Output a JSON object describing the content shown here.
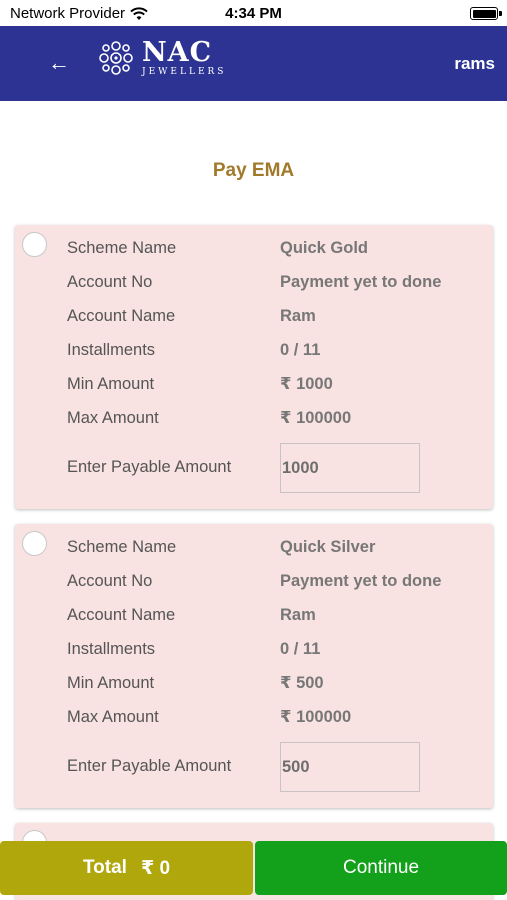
{
  "status_bar": {
    "carrier": "Network Provider",
    "time": "4:34 PM"
  },
  "header": {
    "logo_title": "NAC",
    "logo_subtitle": "JEWELLERS",
    "user_name": "rams",
    "colors": {
      "background": "#2c3393",
      "text": "#ffffff"
    },
    "icons": {
      "back": "arrow-left-icon",
      "logo": "nac-emblem-icon"
    }
  },
  "page": {
    "title": "Pay EMA",
    "title_color": "#a0792a"
  },
  "labels": {
    "scheme_name": "Scheme Name",
    "account_no": "Account No",
    "account_name": "Account Name",
    "installments": "Installments",
    "min_amount": "Min Amount",
    "max_amount": "Max Amount",
    "enter_payable_amount": "Enter Payable Amount"
  },
  "schemes": [
    {
      "selected": false,
      "scheme_name": "Quick Gold",
      "account_no": "Payment yet to done",
      "account_name": "Ram",
      "installments": "0 / 11",
      "min_amount": "₹ 1000",
      "max_amount": "₹ 100000",
      "payable_amount": "1000"
    },
    {
      "selected": false,
      "scheme_name": "Quick Silver",
      "account_no": "Payment yet to done",
      "account_name": "Ram",
      "installments": "0 / 11",
      "min_amount": "₹ 500",
      "max_amount": "₹ 100000",
      "payable_amount": "500"
    }
  ],
  "footer": {
    "total_label": "Total",
    "total_value": "₹ 0",
    "continue_label": "Continue",
    "colors": {
      "total": "#b0a70c",
      "continue": "#13a01a"
    }
  },
  "card_color": "#f9e2e2"
}
